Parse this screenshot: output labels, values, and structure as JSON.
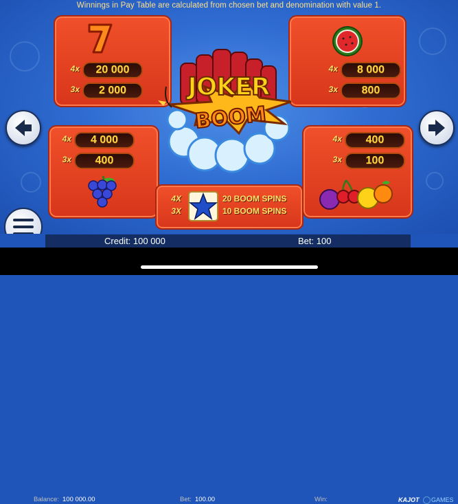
{
  "info_text": "Winnings in Pay Table are calculated from chosen bet and denomination with value 1.",
  "logo": {
    "line1": "JOKER",
    "line2": "BOOM"
  },
  "paytable": {
    "seven": {
      "symbol": "seven-icon",
      "rows": [
        {
          "mult": "4x",
          "value": "20 000"
        },
        {
          "mult": "3x",
          "value": "2 000"
        }
      ]
    },
    "melon": {
      "symbol": "watermelon-icon",
      "rows": [
        {
          "mult": "4x",
          "value": "8 000"
        },
        {
          "mult": "3x",
          "value": "800"
        }
      ]
    },
    "grapes": {
      "symbol": "grapes-icon",
      "rows": [
        {
          "mult": "4x",
          "value": "4 000"
        },
        {
          "mult": "3x",
          "value": "400"
        }
      ]
    },
    "fruits": {
      "symbol": "cherries-icon",
      "rows": [
        {
          "mult": "4x",
          "value": "400"
        },
        {
          "mult": "3x",
          "value": "100"
        }
      ]
    }
  },
  "bonus": {
    "symbol": "star-icon",
    "rows": [
      {
        "mult": "4X",
        "text": "20 BOOM SPINS"
      },
      {
        "mult": "3X",
        "text": "10 BOOM SPINS"
      }
    ]
  },
  "status": {
    "credit": "Credit: 100 000",
    "bet": "Bet: 100"
  },
  "bottom": {
    "balance_label": "Balance:",
    "balance_value": "100 000.00",
    "bet_label": "Bet:",
    "bet_value": "100.00",
    "win_label": "Win:",
    "brand": "KAJOT",
    "brand_suffix": "GAMES"
  },
  "colors": {
    "accent": "#ffd640",
    "panel": "#e0401f",
    "background": "#2f6cd2"
  }
}
